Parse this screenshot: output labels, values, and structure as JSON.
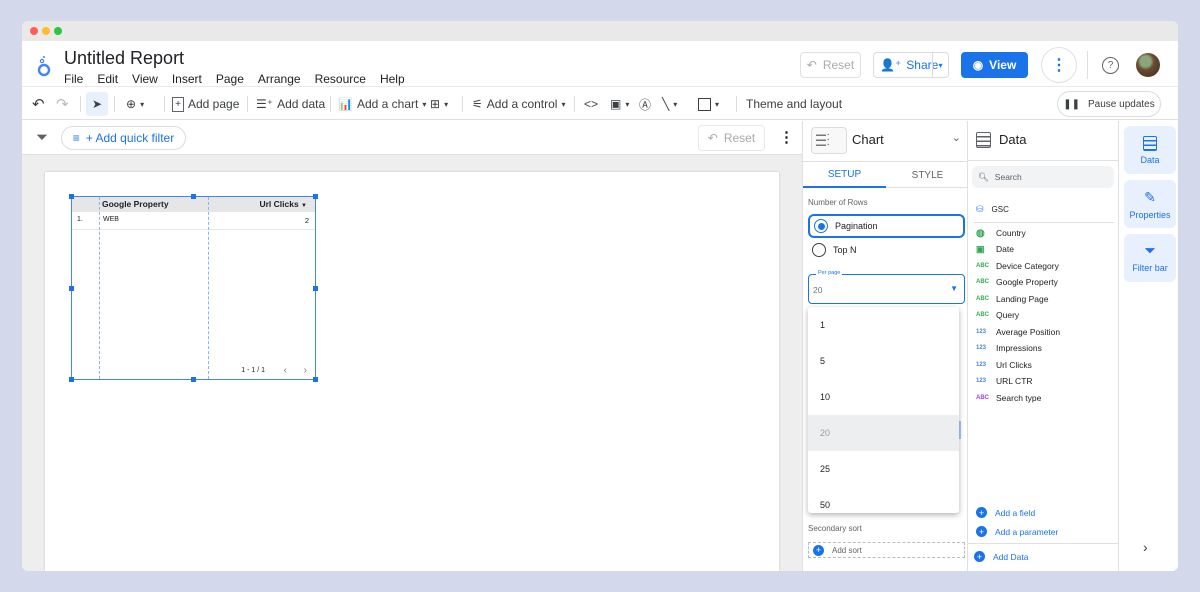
{
  "window": {
    "controls": [
      {
        "name": "close",
        "color": "#ff5f57"
      },
      {
        "name": "minimize",
        "color": "#febc2e"
      },
      {
        "name": "maximize",
        "color": "#28c840"
      }
    ]
  },
  "header": {
    "title": "Untitled Report",
    "menu": [
      "File",
      "Edit",
      "View",
      "Insert",
      "Page",
      "Arrange",
      "Resource",
      "Help"
    ],
    "reset_label": "Reset",
    "share_label": "Share",
    "view_label": "View"
  },
  "toolbar": {
    "add_page": "Add page",
    "add_data": "Add data",
    "add_chart": "Add a chart",
    "add_control": "Add a control",
    "theme": "Theme and layout",
    "pause": "Pause updates"
  },
  "filterbar": {
    "quick_filter": "+ Add quick filter",
    "reset_label": "Reset"
  },
  "table": {
    "columns": [
      "Google Property",
      "Url Clicks"
    ],
    "rows": [
      {
        "index": "1.",
        "property": "WEB",
        "clicks": "2"
      }
    ],
    "pagination": "1 - 1 / 1"
  },
  "setup_panel": {
    "chart_type": "Chart",
    "tabs": [
      "SETUP",
      "STYLE"
    ],
    "rows_label": "Number of Rows",
    "options": [
      "Pagination",
      "Top N"
    ],
    "per_page_label": "Per page",
    "per_page_value": "20",
    "dropdown_options": [
      "1",
      "5",
      "10",
      "20",
      "25",
      "50"
    ],
    "selected_option": "20",
    "secondary_sort": "Secondary sort",
    "add_sort": "Add sort"
  },
  "data_panel": {
    "title": "Data",
    "search_placeholder": "Search",
    "source": "GSC",
    "fields": [
      {
        "type": "geo",
        "name": "Country"
      },
      {
        "type": "date",
        "name": "Date"
      },
      {
        "type": "ABC",
        "name": "Device Category"
      },
      {
        "type": "ABC",
        "name": "Google Property"
      },
      {
        "type": "ABC",
        "name": "Landing Page"
      },
      {
        "type": "ABC",
        "name": "Query"
      },
      {
        "type": "123",
        "name": "Average Position"
      },
      {
        "type": "123",
        "name": "Impressions"
      },
      {
        "type": "123",
        "name": "Url Clicks"
      },
      {
        "type": "123",
        "name": "URL CTR"
      },
      {
        "type": "ABC-purple",
        "name": "Search type"
      }
    ],
    "add_field": "Add a field",
    "add_parameter": "Add a parameter",
    "add_data": "Add Data"
  },
  "rail": {
    "items": [
      "Data",
      "Properties",
      "Filter bar"
    ]
  },
  "colors": {
    "accent": "#1a73e8",
    "dimension": "#34a853",
    "metric": "#4285f4",
    "param": "#a142f4"
  }
}
